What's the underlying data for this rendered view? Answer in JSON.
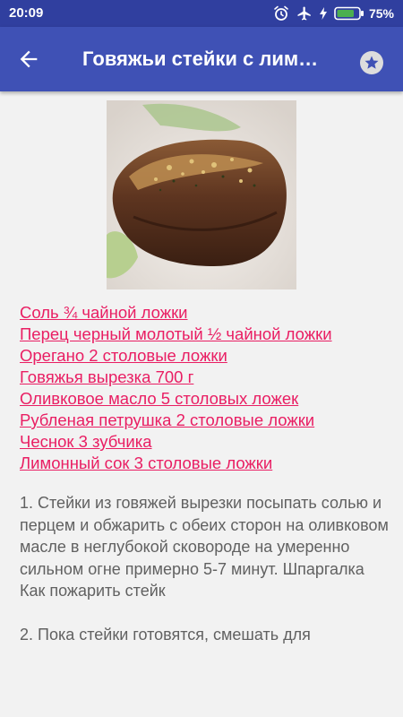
{
  "status_bar": {
    "time": "20:09",
    "battery_percent": "75%",
    "icons": [
      "alarm-icon",
      "airplane-mode-icon",
      "battery-charging-icon"
    ]
  },
  "app_bar": {
    "title": "Говяжьи стейки с лим…",
    "back_icon": "arrow-back-icon",
    "favorite_icon": "star-icon"
  },
  "recipe": {
    "image_description_icon": "recipe-photo",
    "ingredients": [
      "Соль ¾ чайной ложки",
      "Перец черный молотый ½ чайной ложки",
      "Орегано 2 столовые ложки",
      "Говяжья вырезка 700 г",
      "Оливковое масло 5 столовых ложек",
      "Рубленая петрушка 2 столовые ложки",
      "Чеснок 3 зубчика",
      "Лимонный сок 3 столовые ложки"
    ],
    "steps": [
      "1. Стейки из говяжей вырезки посыпать солью и перцем и обжарить с обеих сторон на оливковом масле в неглубокой сковороде на умеренно сильном огне примерно 5-7 минут. Шпаргалка Как пожарить стейк",
      "2. Пока стейки готовятся, смешать для"
    ]
  },
  "colors": {
    "status_bar": "#303f9f",
    "app_bar": "#3f51b5",
    "ingredient_link": "#e91e63",
    "body_text": "#616161",
    "background": "#f2f2f2"
  }
}
